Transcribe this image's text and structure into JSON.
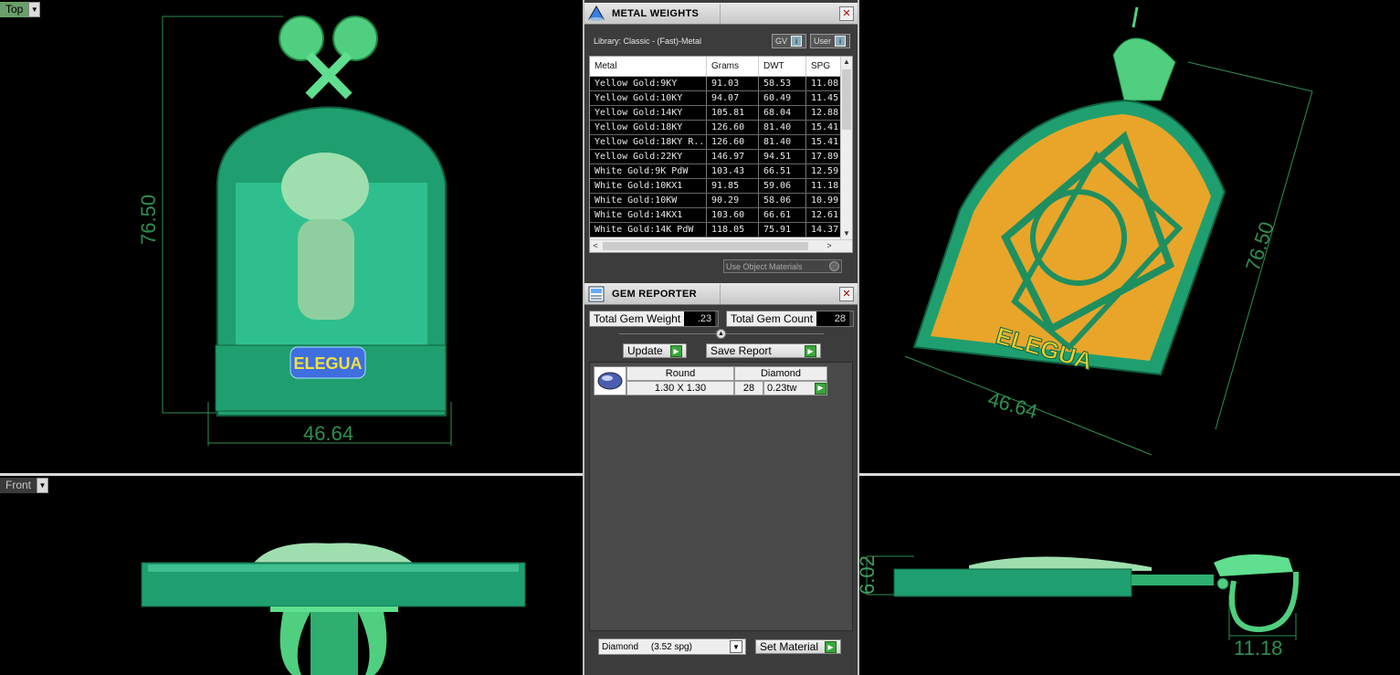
{
  "viewports": {
    "top_label": "Top",
    "front_label": "Front",
    "dims": {
      "tl_height": "76.50",
      "tl_width": "46.64",
      "tr_height": "76.50",
      "tr_width": "46.64",
      "br_height": "6.02",
      "br_width": "11.18"
    },
    "pendant_text": "ELEGUA"
  },
  "metal_weights": {
    "title": "METAL WEIGHTS",
    "library": "Library: Classic - (Fast)-Metal",
    "toggle_gv": "GV",
    "toggle_user": "User",
    "columns": [
      "Metal",
      "Grams",
      "DWT",
      "SPG"
    ],
    "rows": [
      [
        "Yellow Gold:9KY",
        "91.03",
        "58.53",
        "11.08"
      ],
      [
        "Yellow Gold:10KY",
        "94.07",
        "60.49",
        "11.45"
      ],
      [
        "Yellow Gold:14KY",
        "105.81",
        "68.04",
        "12.88"
      ],
      [
        "Yellow Gold:18KY",
        "126.60",
        "81.40",
        "15.41"
      ],
      [
        "Yellow Gold:18KY R...",
        "126.60",
        "81.40",
        "15.41"
      ],
      [
        "Yellow Gold:22KY",
        "146.97",
        "94.51",
        "17.89"
      ],
      [
        "White Gold:9K PdW",
        "103.43",
        "66.51",
        "12.59"
      ],
      [
        "White Gold:10KX1",
        "91.85",
        "59.06",
        "11.18"
      ],
      [
        "White Gold:10KW",
        "90.29",
        "58.06",
        "10.99"
      ],
      [
        "White Gold:14KX1",
        "103.60",
        "66.61",
        "12.61"
      ],
      [
        "White Gold:14K PdW",
        "118.05",
        "75.91",
        "14.37"
      ]
    ],
    "use_object_materials": "Use Object Materials"
  },
  "gem_reporter": {
    "title": "GEM REPORTER",
    "total_weight_label": "Total Gem Weight",
    "total_weight_value": ".23",
    "total_count_label": "Total Gem Count",
    "total_count_value": "28",
    "update_label": "Update",
    "save_report_label": "Save Report",
    "gem": {
      "shape": "Round",
      "material": "Diamond",
      "size": "1.30 X 1.30",
      "count": "28",
      "weight": "0.23tw"
    },
    "material_select": "Diamond     (3.52 spg)",
    "set_material_label": "Set Material"
  }
}
